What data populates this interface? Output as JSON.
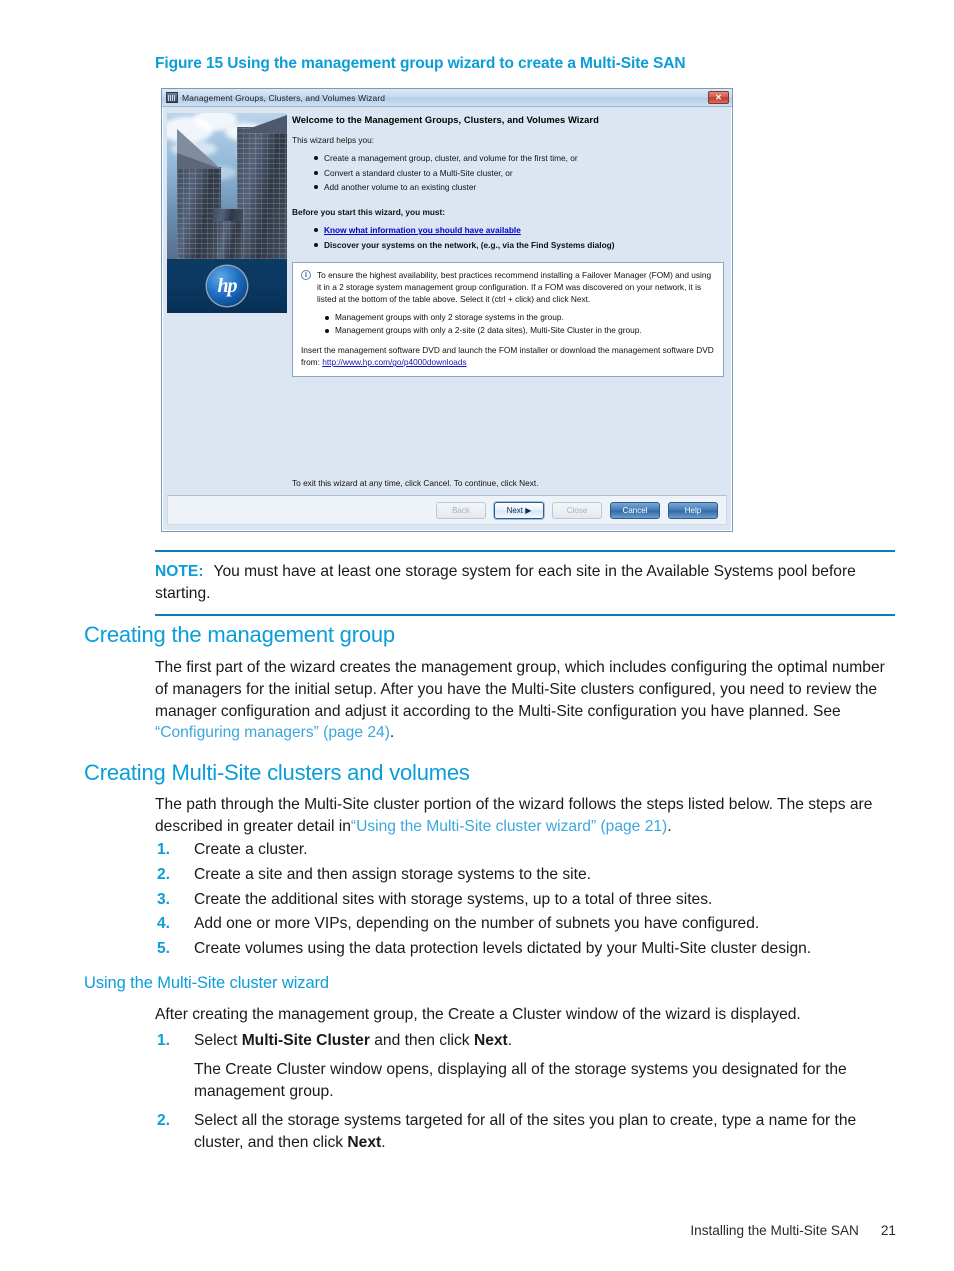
{
  "figure": {
    "caption": "Figure 15 Using the management group wizard to create a Multi-Site SAN"
  },
  "wizard": {
    "title": "Management Groups, Clusters, and Volumes Wizard",
    "close_label": "✕",
    "logo_text": "hp",
    "heading": "Welcome to the Management Groups, Clusters, and Volumes Wizard",
    "intro": "This wizard helps you:",
    "helps_items": [
      "Create a management group, cluster, and volume for the first time, or",
      "Convert a standard cluster to a Multi-Site cluster, or",
      "Add another volume to an existing cluster"
    ],
    "before_heading": "Before you start this wizard, you must:",
    "before_items": [
      "Know what information you should have available",
      "Discover your systems on the network, (e.g., via the Find Systems dialog)"
    ],
    "tip": {
      "icon": "info-icon",
      "paragraph": "To ensure the highest availability, best practices recommend installing a Failover Manager (FOM) and using it in a 2 storage system management group configuration. If a FOM was discovered on your network, it is listed at the bottom of the table above. Select it (ctrl + click) and click Next.",
      "items": [
        "Management groups with only 2 storage systems in the group.",
        "Management groups with only a 2-site (2 data sites), Multi-Site Cluster in the group."
      ],
      "footer_text": "Insert the management software DVD and launch the FOM installer or download the management software DVD from: ",
      "footer_url": "http://www.hp.com/go/p4000downloads"
    },
    "exit_text": "To exit this wizard at any time, click Cancel. To continue, click Next.",
    "buttons": [
      {
        "label": "Back",
        "state": "disabled"
      },
      {
        "label": "Next ▶",
        "state": "primary"
      },
      {
        "label": "Close",
        "state": "disabled"
      },
      {
        "label": "Cancel",
        "state": "enabled"
      },
      {
        "label": "Help",
        "state": "enabled"
      }
    ]
  },
  "note": {
    "label": "NOTE:",
    "text": "You must have at least one storage system for each site in the Available Systems pool before starting."
  },
  "sections": {
    "creating_mgmt_group": {
      "heading": "Creating the management group",
      "body_before_link": "The first part of the wizard creates the management group, which includes configuring the optimal number of managers for the initial setup. After you have the Multi-Site clusters configured, you need to review the manager configuration and adjust it according to the Multi-Site configuration you have planned. See ",
      "link": "“Configuring managers” (page 24)",
      "body_after_link": "."
    },
    "creating_clusters": {
      "heading": "Creating Multi-Site clusters and volumes",
      "body_before_link": "The path through the Multi-Site cluster portion of the wizard follows the steps listed below. The steps are described in greater detail in",
      "link": "“Using the Multi-Site cluster wizard” (page 21)",
      "body_after_link": ".",
      "steps": [
        {
          "num": "1.",
          "text": "Create a cluster."
        },
        {
          "num": "2.",
          "text": "Create a site and then assign storage systems to the site."
        },
        {
          "num": "3.",
          "text": "Create the additional sites with storage systems, up to a total of three sites."
        },
        {
          "num": "4.",
          "text": "Add one or more VIPs, depending on the number of subnets you have configured."
        },
        {
          "num": "5.",
          "text": "Create volumes using the data protection levels dictated by your Multi-Site cluster design."
        }
      ]
    },
    "using_wizard": {
      "heading": "Using the Multi-Site cluster wizard",
      "intro": "After creating the management group, the Create a Cluster window of the wizard is displayed.",
      "step1_num": "1.",
      "step1_pre": "Select ",
      "step1_bold1": "Multi-Site Cluster",
      "step1_mid": " and then click ",
      "step1_bold2": "Next",
      "step1_post": ".",
      "step1_detail": "The Create Cluster window opens, displaying all of the storage systems you designated for the management group.",
      "step2_num": "2.",
      "step2_pre": "Select all the storage systems targeted for all of the sites you plan to create, type a name for the cluster, and then click ",
      "step2_bold": "Next",
      "step2_post": "."
    }
  },
  "footer": {
    "text": "Installing the Multi-Site SAN",
    "page": "21"
  },
  "colors": {
    "accent": "#0b9dd8",
    "rule": "#0b7fb5",
    "xref": "#3ba7dc",
    "wizard_link": "#0000cc"
  }
}
